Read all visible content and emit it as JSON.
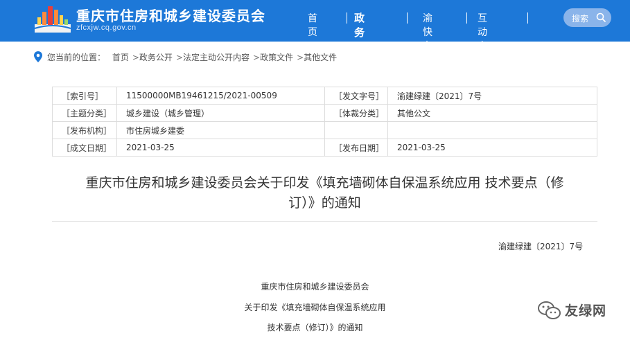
{
  "header": {
    "site_title": "重庆市住房和城乡建设委员会",
    "site_url": "zfcxjw.cq.gov.cn",
    "nav": [
      {
        "label": "首页"
      },
      {
        "label": "政务公开"
      },
      {
        "label": "渝快办"
      },
      {
        "label": "互动交流"
      }
    ],
    "search_label": "搜索",
    "colors": {
      "bar": "#1d78d8",
      "search_bg": "#8ab4ea"
    }
  },
  "breadcrumb": {
    "prefix": "您当前的位置：",
    "items": [
      "首页",
      "政务公开",
      "法定主动公开内容",
      "政策文件",
      "其他文件"
    ],
    "separator": ">"
  },
  "meta": {
    "index_label": "［索引号］",
    "index_value": "11500000MB19461215/2021-00509",
    "docno_label": "［发文字号］",
    "docno_value": "渝建绿建〔2021〕7号",
    "topic_label": "［主题分类］",
    "topic_value": "城乡建设（城乡管理）",
    "genre_label": "［体裁分类］",
    "genre_value": "其他公文",
    "issuer_label": "［发布机构］",
    "issuer_value": "市住房城乡建委",
    "created_label": "［成文日期］",
    "created_value": "2021-03-25",
    "published_label": "［发布日期］",
    "published_value": "2021-03-25"
  },
  "article": {
    "title_line1": "重庆市住房和城乡建设委员会关于印发《填充墙砌体自保温系统应用 技术要点（修",
    "title_line2": "订）》的通知",
    "doc_no": "渝建绿建〔2021〕7号",
    "body": [
      "重庆市住房和城乡建设委员会",
      "关于印发《填充墙砌体自保温系统应用",
      "技术要点（修订）》的通知"
    ]
  },
  "watermark": {
    "text": "友绿网",
    "icon": "wechat-icon"
  }
}
